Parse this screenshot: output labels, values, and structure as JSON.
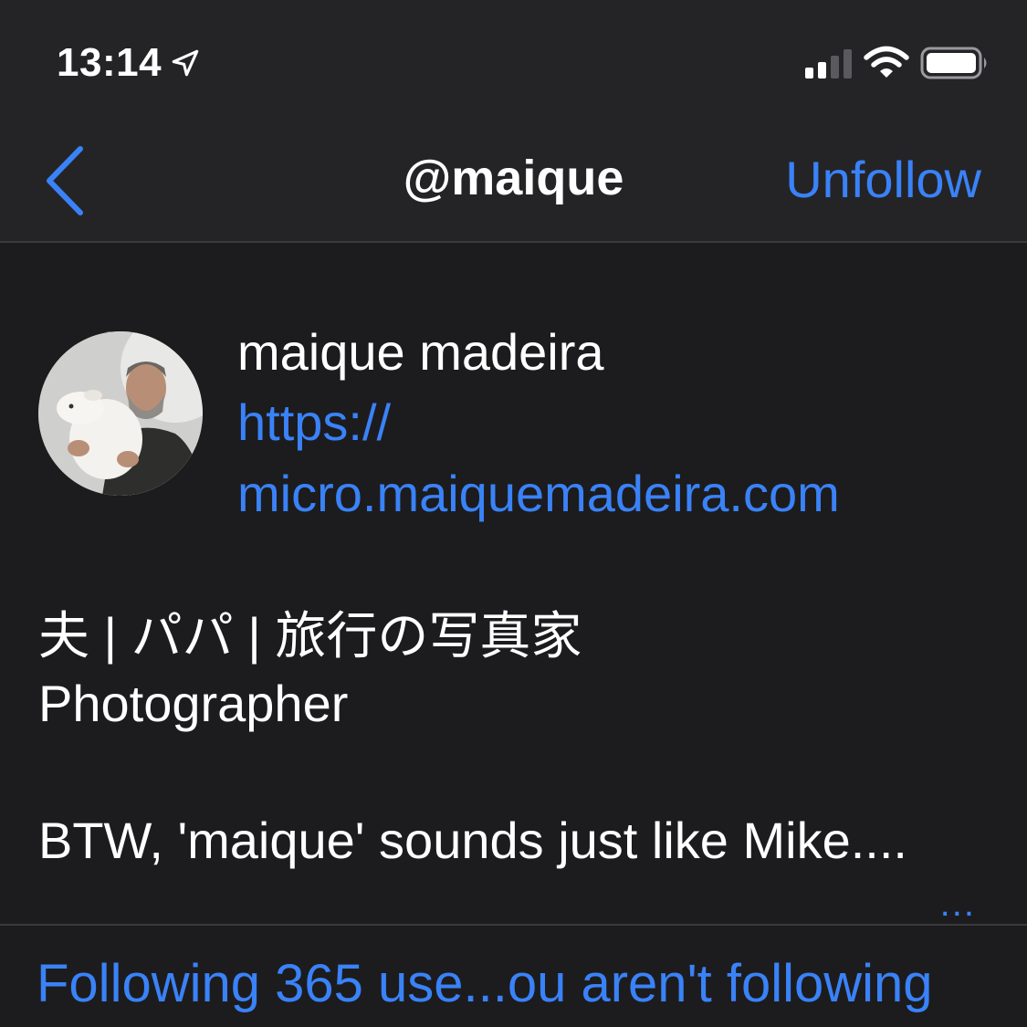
{
  "status_bar": {
    "time": "13:14",
    "icons": [
      "location-arrow-icon",
      "cellular-signal-icon",
      "wifi-icon",
      "battery-icon"
    ]
  },
  "nav": {
    "back_icon": "chevron-left-icon",
    "title": "@maique",
    "unfollow_label": "Unfollow"
  },
  "profile": {
    "name": "maique madeira",
    "link_line1": "https://",
    "link_line2": "micro.maiquemadeira.com",
    "bio_line1": "夫 | パパ | 旅行の写真家",
    "bio_line2": "Photographer",
    "bio_line3": "BTW, 'maique' sounds just like Mike....",
    "more": "..."
  },
  "footer": {
    "following_text": "Following 365 use...ou aren't following"
  },
  "colors": {
    "accent": "#3a82f7",
    "background": "#1c1c1e",
    "bar_background": "#242426",
    "text": "#ffffff"
  }
}
